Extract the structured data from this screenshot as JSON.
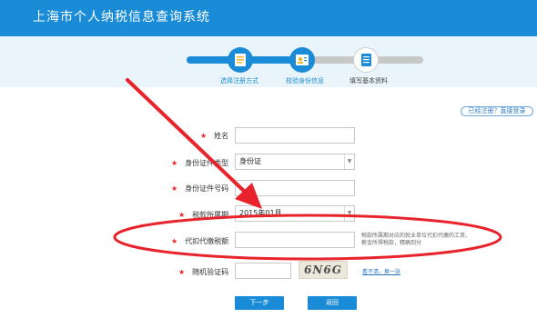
{
  "header": {
    "title": "上海市个人纳税信息查询系统"
  },
  "steps": [
    {
      "label": "选择注册方式",
      "icon": "registration-form-icon",
      "state": "done"
    },
    {
      "label": "校验身份信息",
      "icon": "id-card-icon",
      "state": "done"
    },
    {
      "label": "填写基本资料",
      "icon": "document-list-icon",
      "state": "pending"
    }
  ],
  "login_link": "已经注册？直接登录",
  "form": {
    "required_mark": "★",
    "name_label": "姓名",
    "id_type_label": "身份证件类型",
    "id_type_value": "身份证",
    "id_number_label": "身份证件号码",
    "tax_period_label": "税款所属期",
    "tax_period_value": "2015年01月",
    "withholding_label": "代扣代缴税额",
    "withholding_hint": "税款所属期对应的就业单位代扣代缴的工资、薪金所得税款，精确到分",
    "captcha_label": "随机验证码",
    "captcha_text": "6N6G",
    "captcha_refresh": "看不清，换一张"
  },
  "buttons": {
    "next": "下一步",
    "back": "返回"
  },
  "colors": {
    "header": "#1a8bd6",
    "annotation": "#e8232b",
    "required": "#e22222"
  }
}
